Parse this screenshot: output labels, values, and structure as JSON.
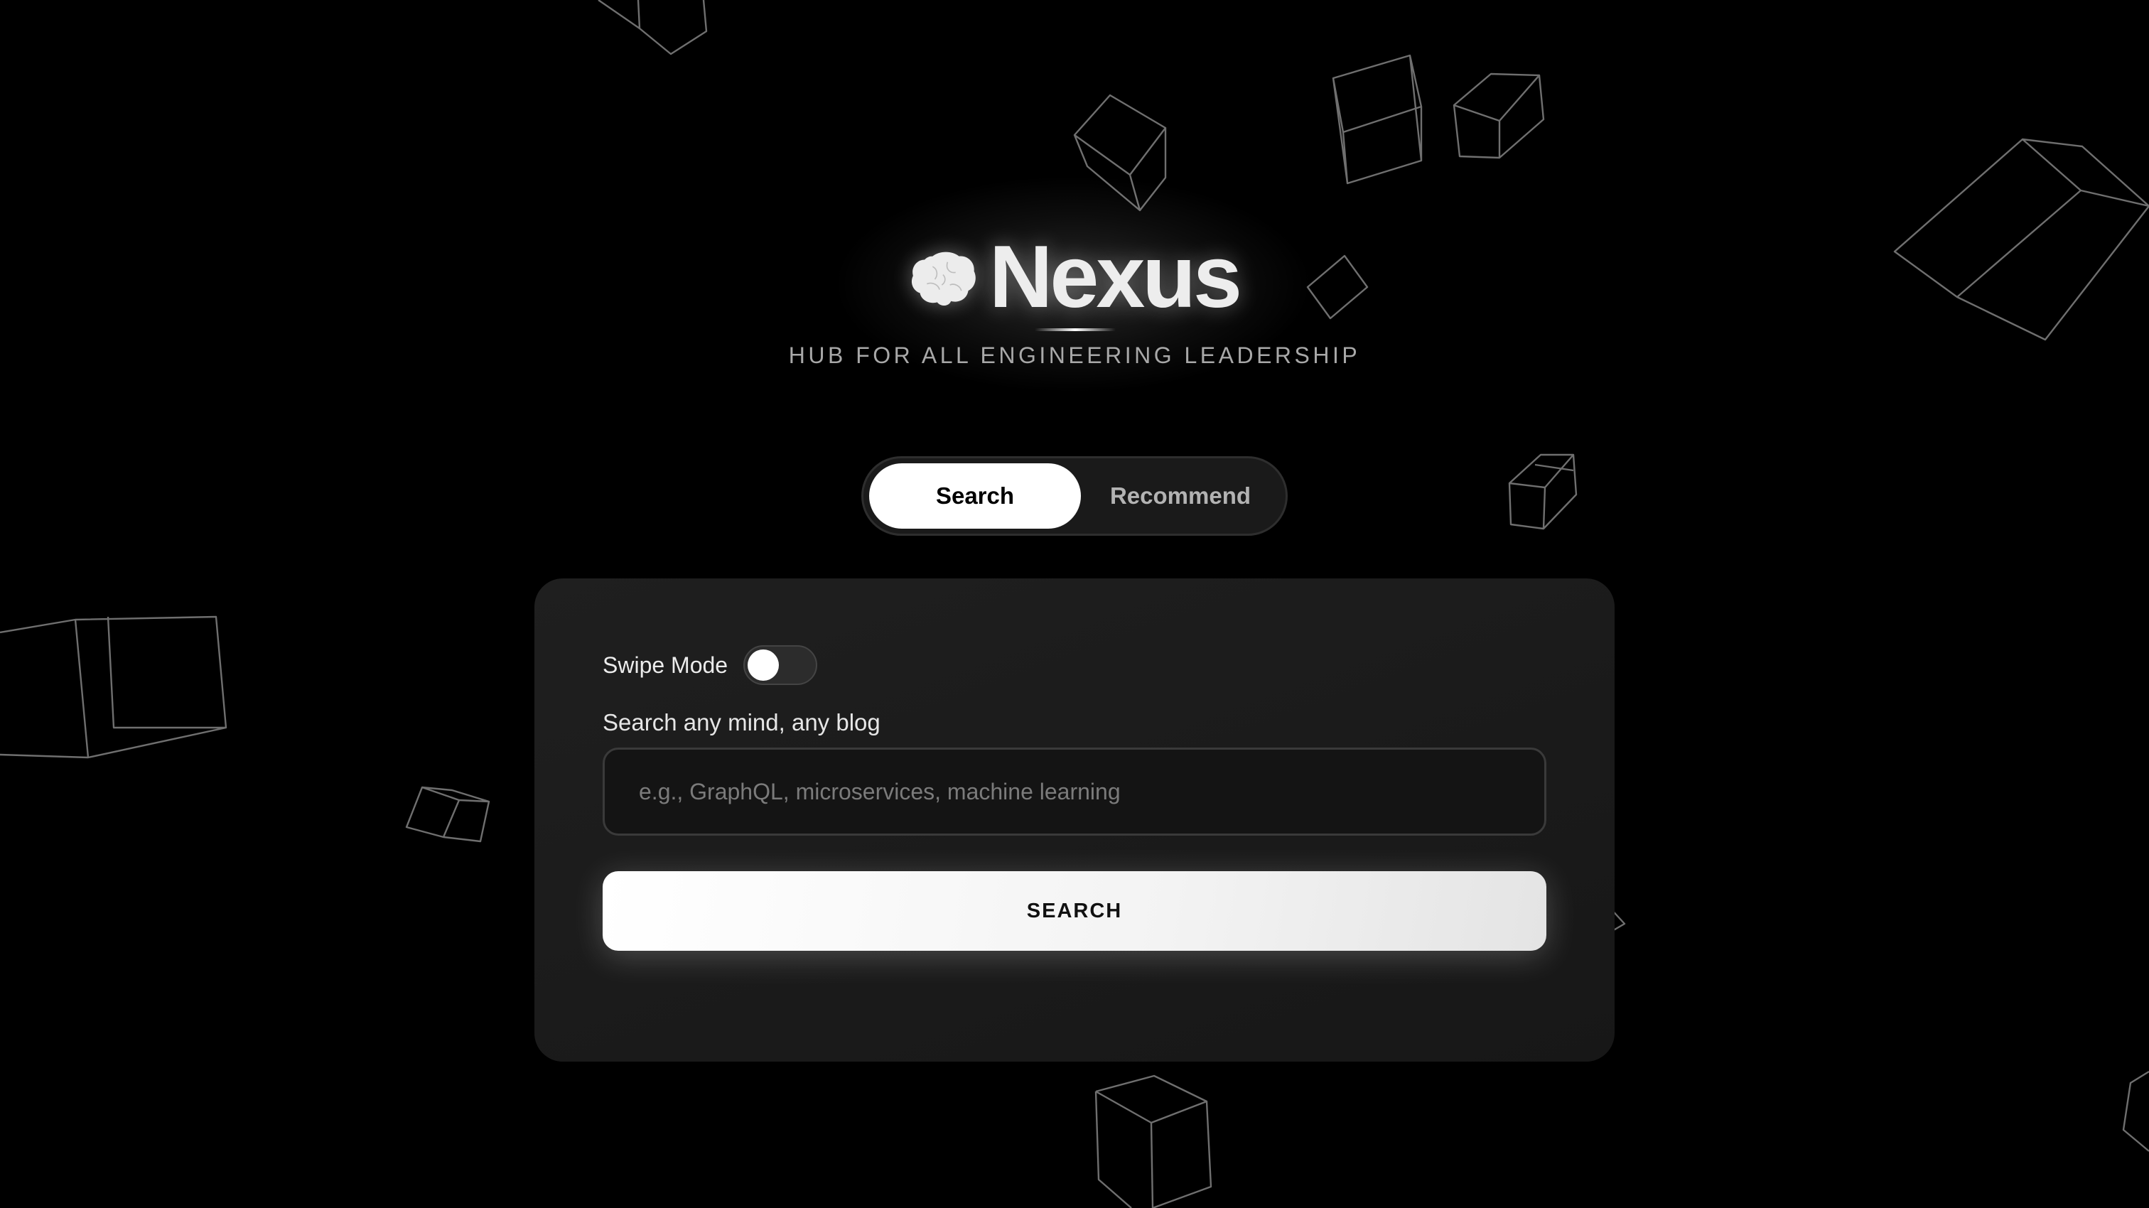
{
  "brand": {
    "title": "Nexus",
    "tagline": "HUB FOR ALL ENGINEERING LEADERSHIP",
    "icon": "brain-icon"
  },
  "mode_toggle": {
    "tabs": [
      {
        "label": "Search",
        "active": true
      },
      {
        "label": "Recommend",
        "active": false
      }
    ]
  },
  "panel": {
    "swipe_mode": {
      "label": "Swipe Mode",
      "enabled": false
    },
    "search": {
      "label": "Search any mind, any blog",
      "value": "",
      "placeholder": "e.g., GraphQL, microservices, machine learning",
      "button_label": "SEARCH"
    }
  },
  "colors": {
    "background": "#000000",
    "panel": "#1c1c1c",
    "accent": "#ffffff",
    "muted_text": "#a8a8a8"
  }
}
